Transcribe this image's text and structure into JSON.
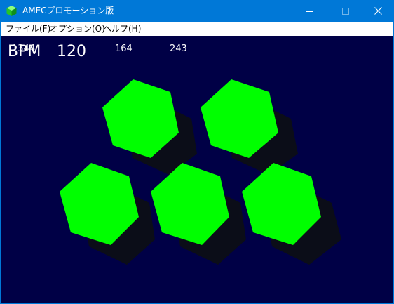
{
  "window": {
    "title": "AMECプロモーション版",
    "colors": {
      "titlebar": "#0078d7",
      "canvas_bg": "#000046",
      "hexagon": "#00ff00",
      "shadow": "#0b0d18"
    }
  },
  "menu": {
    "items": [
      {
        "label": "ファイル(F)"
      },
      {
        "label": "オプション(O)"
      },
      {
        "label": "ヘルプ(H)"
      }
    ]
  },
  "display": {
    "bpm_label": "BPM",
    "bpm_value": "120",
    "numbers": [
      "1344",
      "164",
      "243"
    ]
  },
  "icons": {
    "app": "green-cube-icon",
    "minimize": "minimize-icon",
    "maximize": "maximize-icon",
    "close": "close-icon"
  }
}
